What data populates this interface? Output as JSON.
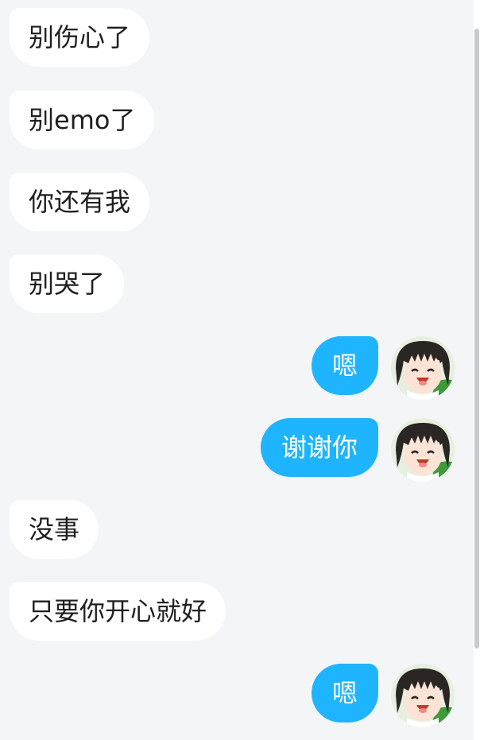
{
  "messages": [
    {
      "side": "in",
      "text": "别伤心了"
    },
    {
      "side": "in",
      "text": "别emo了"
    },
    {
      "side": "in",
      "text": "你还有我"
    },
    {
      "side": "in",
      "text": "别哭了"
    },
    {
      "side": "out",
      "text": "嗯"
    },
    {
      "side": "out",
      "text": "谢谢你"
    },
    {
      "side": "in",
      "text": "没事"
    },
    {
      "side": "in",
      "text": "只要你开心就好"
    },
    {
      "side": "out",
      "text": "嗯"
    }
  ],
  "colors": {
    "background": "#f4f5f7",
    "incoming_bubble": "#ffffff",
    "outgoing_bubble": "#1fb4ff",
    "incoming_text": "#1f1f1f",
    "outgoing_text": "#ffffff"
  },
  "icons": {
    "avatar": "anime-girl-avatar"
  }
}
